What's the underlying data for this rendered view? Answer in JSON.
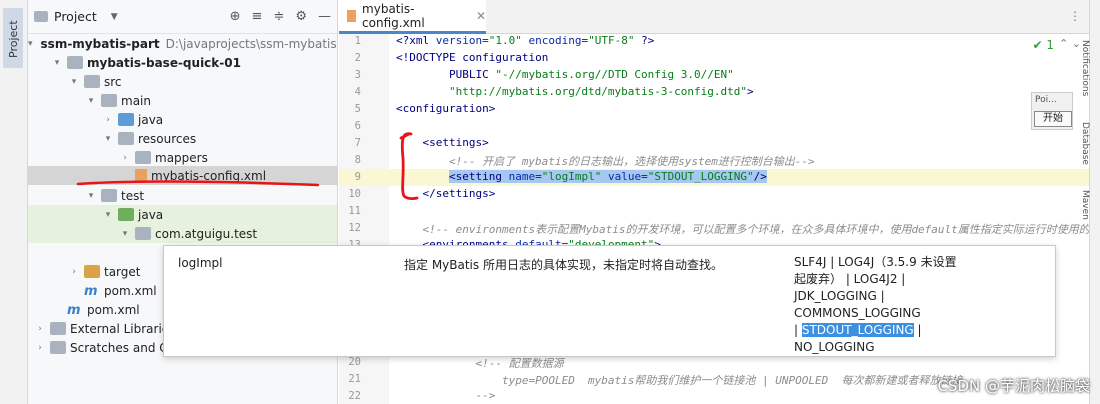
{
  "project_panel": {
    "title": "Project",
    "tool_tab": "Project",
    "tree": [
      {
        "label": "ssm-mybatis-part",
        "path": "D:\\javaprojects\\ssm-mybatis-part",
        "icon": "folder-icon",
        "depth": 0,
        "expanded": true,
        "bold": true
      },
      {
        "label": "mybatis-base-quick-01",
        "depth": 1,
        "expanded": true,
        "bold": true,
        "icon": "folder-icon"
      },
      {
        "label": "src",
        "depth": 2,
        "expanded": true,
        "icon": "folder-icon"
      },
      {
        "label": "main",
        "depth": 3,
        "expanded": true,
        "icon": "folder-icon"
      },
      {
        "label": "java",
        "depth": 4,
        "expanded": false,
        "icon": "source-folder-icon"
      },
      {
        "label": "resources",
        "depth": 4,
        "expanded": true,
        "icon": "resources-folder-icon"
      },
      {
        "label": "mappers",
        "depth": 5,
        "expanded": false,
        "icon": "folder-icon"
      },
      {
        "label": "mybatis-config.xml",
        "depth": 5,
        "icon": "xml-file-icon",
        "selected": true
      },
      {
        "label": "test",
        "depth": 3,
        "expanded": true,
        "icon": "folder-icon"
      },
      {
        "label": "java",
        "depth": 4,
        "expanded": true,
        "icon": "test-folder-icon"
      },
      {
        "label": "com.atguigu.test",
        "depth": 5,
        "expanded": true,
        "icon": "package-icon"
      },
      {
        "label": "target",
        "depth": 2,
        "expanded": false,
        "icon": "target-folder-icon"
      },
      {
        "label": "pom.xml",
        "depth": 2,
        "icon": "maven-icon"
      },
      {
        "label": "pom.xml",
        "depth": 1,
        "icon": "maven-icon"
      },
      {
        "label": "External Libraries",
        "depth": 0,
        "expanded": false,
        "icon": "library-icon"
      },
      {
        "label": "Scratches and Cons",
        "depth": 0,
        "expanded": false,
        "icon": "scratches-icon"
      }
    ]
  },
  "editor": {
    "tab_label": "mybatis-config.xml",
    "inspection_count": "1",
    "lines": [
      {
        "n": "1",
        "html": "<span class='t-tag'>&lt;?xml </span><span class='t-attr'>version</span>=<span class='t-str'>\"1.0\"</span> <span class='t-attr'>encoding</span>=<span class='t-str'>\"UTF-8\"</span> <span class='t-tag'>?&gt;</span>"
      },
      {
        "n": "2",
        "html": "<span class='t-tag'>&lt;!DOCTYPE configuration</span>"
      },
      {
        "n": "3",
        "html": "        <span class='t-tag'>PUBLIC</span> <span class='t-str'>\"-//mybatis.org//DTD Config 3.0//EN\"</span>"
      },
      {
        "n": "4",
        "html": "        <span class='t-str'>\"http://mybatis.org/dtd/mybatis-3-config.dtd\"</span><span class='t-tag'>&gt;</span>"
      },
      {
        "n": "5",
        "html": "<span class='t-tag'>&lt;configuration&gt;</span>"
      },
      {
        "n": "6",
        "html": ""
      },
      {
        "n": "7",
        "html": "    <span class='t-tag'>&lt;settings&gt;</span>"
      },
      {
        "n": "8",
        "html": "        <span class='t-com'>&lt;!-- 开启了 mybatis的日志输出，选择使用system进行控制台输出--&gt;</span>"
      },
      {
        "n": "9",
        "html": "        <span class='sel'><span class='t-tag'>&lt;setting </span><span class='t-attr'>name</span>=<span class='t-str'>\"logImpl\"</span> <span class='t-attr'>value</span>=<span class='t-str'>\"STDOUT_LOGGING\"</span><span class='t-tag'>/&gt;</span></span>",
        "hl": true
      },
      {
        "n": "10",
        "html": "    <span class='t-tag'>&lt;/settings&gt;</span>"
      },
      {
        "n": "11",
        "html": ""
      },
      {
        "n": "12",
        "html": "    <span class='t-com'>&lt;!-- environments表示配置Mybatis的开发环境，可以配置多个环境，在众多具体环境中，使用default属性指定实际运行时使用的</span>"
      },
      {
        "n": "13",
        "html": "    <span class='t-tag'>&lt;environments </span><span class='t-attr'>default</span>=<span class='t-str'>\"development\"</span><span class='t-tag'>&gt;</span>"
      },
      {
        "n": "20",
        "html": "            <span class='t-com'>&lt;!-- 配置数据源</span>"
      },
      {
        "n": "21",
        "html": "                <span class='t-com'>type=POOLED  mybatis帮助我们维护一个链接池 | UNPOOLED  每次都新建或者释放链接</span>"
      },
      {
        "n": "22",
        "html": "            <span class='t-com'>--&gt;</span>"
      }
    ]
  },
  "popup": {
    "setting_name": "logImpl",
    "description": "指定 MyBatis 所用日志的具体实现，未指定时将自动查找。",
    "values_line1": "SLF4J | LOG4J（3.5.9     未设置",
    "values_line2": "起废弃） | LOG4J2 |",
    "values_line3": "JDK_LOGGING |",
    "values_line4": "COMMONS_LOGGING",
    "values_line5_pre": "| ",
    "values_line5_hl": "STDOUT_LOGGING",
    "values_line5_post": " |",
    "values_line6": "NO_LOGGING"
  },
  "mini_widget": {
    "label": "Poi...",
    "button": "开始"
  },
  "right_strip": [
    "Notifications",
    "Database",
    "Maven"
  ],
  "watermark": "CSDN @芋泥肉松脑袋",
  "colors": {
    "annotation_red": "#e8141b",
    "selection": "#a6c7f0",
    "popup_highlight": "#3d8fe0"
  }
}
